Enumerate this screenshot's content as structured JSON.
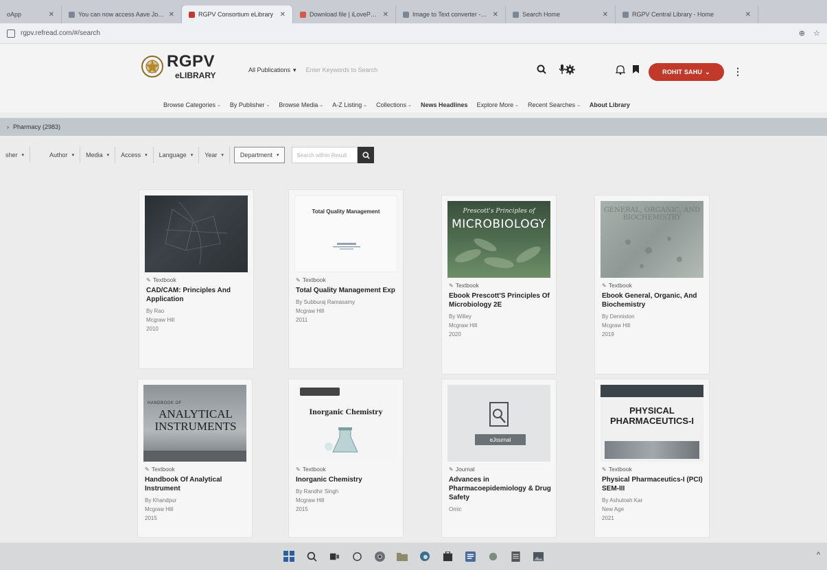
{
  "browser": {
    "tabs": [
      {
        "title": "oApp",
        "active": false
      },
      {
        "title": "You can now access Aave Journ...",
        "active": false
      },
      {
        "title": "RGPV Consortium eLibrary",
        "active": true
      },
      {
        "title": "Download file | iLovePDF",
        "active": false
      },
      {
        "title": "Image to Text converter - Extr...",
        "active": false
      },
      {
        "title": "Search Home",
        "active": false
      },
      {
        "title": "RGPV Central Library - Home",
        "active": false
      }
    ],
    "url": "rgpv.refread.com/#/search"
  },
  "header": {
    "logo_main": "RGPV",
    "logo_sub": "eLIBRARY",
    "publication_select": "All Publications",
    "search_placeholder": "Enter Keywords to Search",
    "user_name": "ROHIT SAHU"
  },
  "nav": [
    {
      "label": "Browse Categories",
      "dropdown": true
    },
    {
      "label": "By Publisher",
      "dropdown": true
    },
    {
      "label": "Browse Media",
      "dropdown": true
    },
    {
      "label": "A-Z Listing",
      "dropdown": true
    },
    {
      "label": "Collections",
      "dropdown": true
    },
    {
      "label": "News Headlines",
      "dropdown": false
    },
    {
      "label": "Explore More",
      "dropdown": true
    },
    {
      "label": "Recent Searches",
      "dropdown": true
    },
    {
      "label": "About Library",
      "dropdown": false
    }
  ],
  "breadcrumb": {
    "label": "Pharmacy (2983)"
  },
  "filters": {
    "items": [
      "sher",
      "Author",
      "Media",
      "Access",
      "Language",
      "Year",
      "Department"
    ],
    "search_placeholder": "Search within Result"
  },
  "results": [
    {
      "type": "Textbook",
      "title": "CAD/CAM: Principles And Application",
      "author": "By Rao",
      "publisher": "Mcgraw Hill",
      "year": "2010",
      "cover": "cad"
    },
    {
      "type": "Textbook",
      "title": "Total Quality Management Exp",
      "author": "By Subburaj Ramasamy",
      "publisher": "Mcgraw Hill",
      "year": "2011",
      "cover": "tqm",
      "cover_text": "Total Quality Management"
    },
    {
      "type": "Textbook",
      "title": "Ebook Prescott'S Principles Of Microbiology 2E",
      "author": "By Willey",
      "publisher": "Mcgraw Hill",
      "year": "2020",
      "cover": "micro",
      "cover_sub": "Prescott's Principles of",
      "cover_text": "MICROBIOLOGY"
    },
    {
      "type": "Textbook",
      "title": "Ebook General, Organic, And Biochemistry",
      "author": "By Denniston",
      "publisher": "Mcgraw Hill",
      "year": "2019",
      "cover": "biochem",
      "cover_text": "GENERAL, ORGANIC, AND BIOCHEMISTRY"
    },
    {
      "type": "Textbook",
      "title": "Handbook Of Analytical Instrument",
      "author": "By Khandpur",
      "publisher": "Mcgraw Hill",
      "year": "2015",
      "cover": "analy",
      "cover_small": "HANDBOOK OF",
      "cover_text": "ANALYTICAL INSTRUMENTS"
    },
    {
      "type": "Textbook",
      "title": "Inorganic Chemistry",
      "author": "By Randhir Singh",
      "publisher": "Mcgraw Hill",
      "year": "2015",
      "cover": "inorg",
      "cover_text": "Inorganic Chemistry"
    },
    {
      "type": "Journal",
      "title": "Advances in Pharmacoepidemiology & Drug Safety",
      "author": "",
      "publisher": "Omic",
      "year": "",
      "cover": "ejournal",
      "cover_text": "eJournal"
    },
    {
      "type": "Textbook",
      "title": "Physical Pharmaceutics-I (PCI) SEM-III",
      "author": "By Ashutosh Kar",
      "publisher": "New Age",
      "year": "2021",
      "cover": "phys",
      "cover_text": "PHYSICAL PHARMACEUTICS-I"
    }
  ],
  "colors": {
    "accent_red": "#c0392b",
    "crumb_band": "#c2c7cc",
    "header_bg": "#f4f4f4"
  }
}
